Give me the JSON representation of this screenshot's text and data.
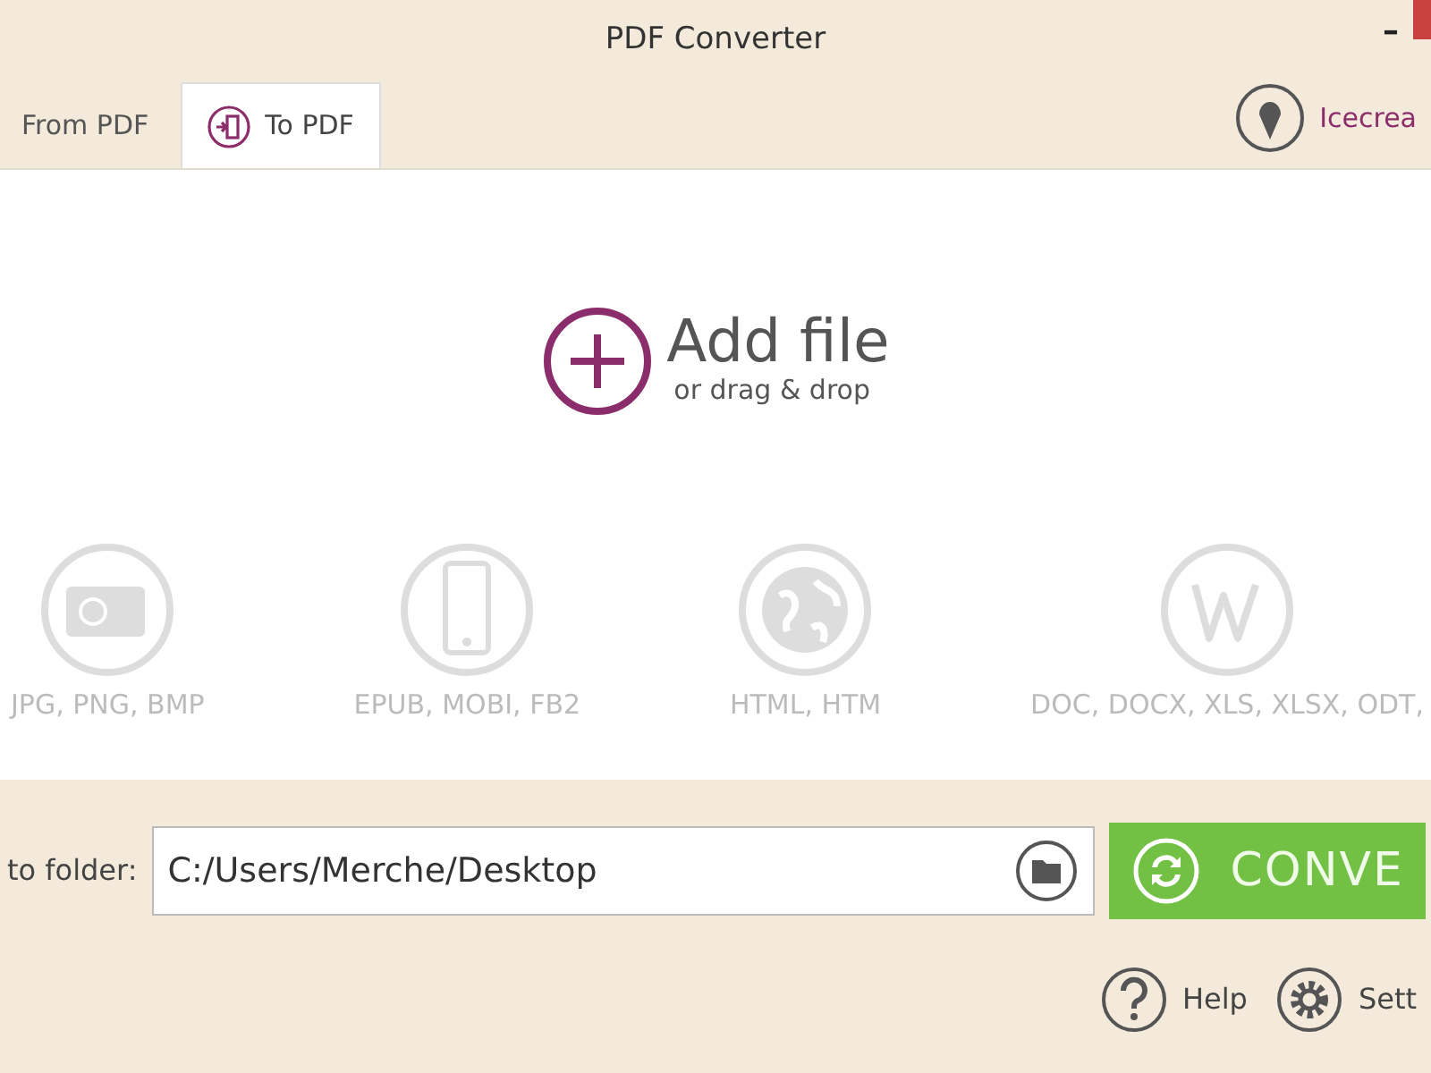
{
  "window": {
    "title": "PDF Converter",
    "minimize": "–"
  },
  "tabs": [
    {
      "label": "From PDF",
      "selected": false,
      "kind": "plain"
    },
    {
      "label": "To PDF",
      "selected": true,
      "kind": "icon"
    }
  ],
  "brand": {
    "label": "Icecrea"
  },
  "drop_zone": {
    "title": "Add file",
    "subtitle": "or drag & drop"
  },
  "formats": [
    {
      "kind": "camera",
      "label": "JPG, PNG, BMP"
    },
    {
      "kind": "phone",
      "label": "EPUB, MOBI, FB2"
    },
    {
      "kind": "globe",
      "label": "HTML, HTM"
    },
    {
      "kind": "word",
      "label": "DOC, DOCX, XLS, XLSX, ODT,"
    }
  ],
  "save": {
    "label": "to folder:",
    "path": "C:/Users/Merche/Desktop"
  },
  "convert_button": {
    "label": "CONVE"
  },
  "footer": [
    {
      "kind": "help",
      "label": "Help"
    },
    {
      "kind": "settings",
      "label": "Sett"
    }
  ]
}
